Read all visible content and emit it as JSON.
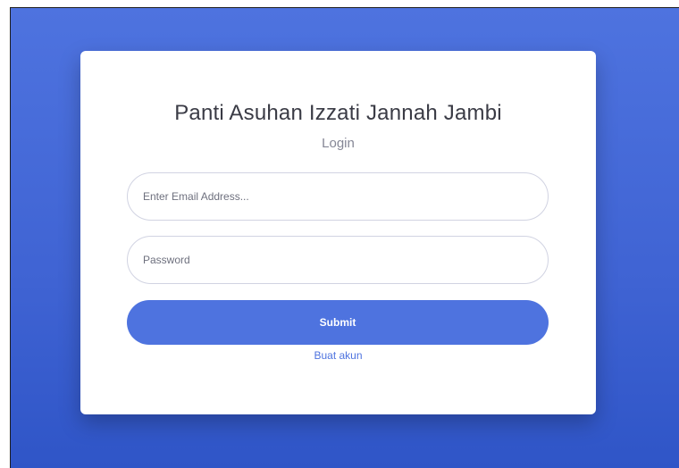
{
  "login": {
    "title": "Panti Asuhan Izzati Jannah Jambi",
    "subtitle": "Login",
    "email_placeholder": "Enter Email Address...",
    "password_placeholder": "Password",
    "submit_label": "Submit",
    "register_link": "Buat akun"
  },
  "colors": {
    "primary": "#4e73df",
    "background": "#4e73df"
  }
}
